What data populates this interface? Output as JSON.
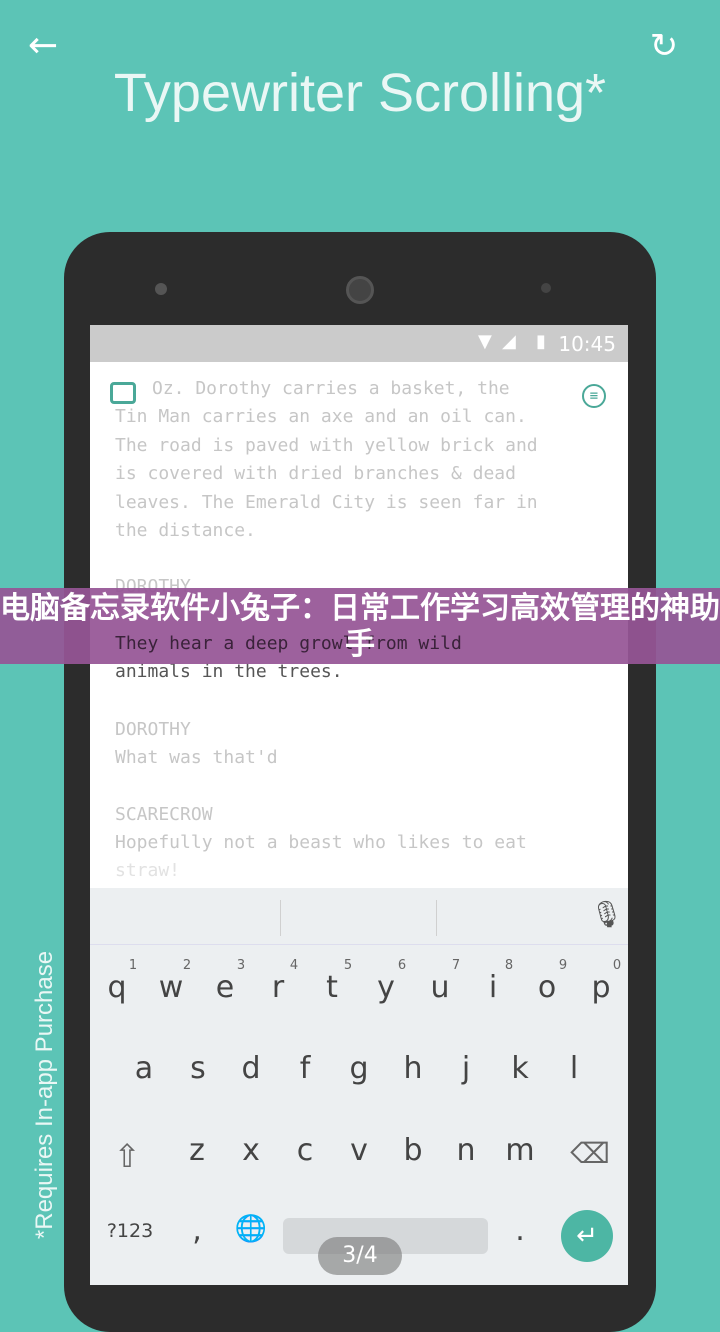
{
  "viewer": {
    "back_icon": "arrow-left-icon",
    "rotate_icon": "rotate-icon",
    "page_indicator": "3/4"
  },
  "banner": {
    "title": "电脑备忘录软件小兔子：日常工作学习高效管理的神助手"
  },
  "image": {
    "headline": "Typewriter Scrolling*",
    "footnote": "*Requires In-app Purchase",
    "status_time": "10:45",
    "doc_lines": [
      "Oz. Dorothy carries a basket, the",
      "Tin Man carries an axe and an oil can.",
      "The road is paved with yellow brick and",
      "is covered with dried branches & dead",
      "leaves. The Emerald City is seen far in",
      "the distance."
    ],
    "char1": "DOROTHY",
    "line1a": "They hear a deep growl from wild",
    "line1b": "animals in the trees.",
    "char2": "DOROTHY",
    "line2": "What was that'd",
    "char3": "SCARECROW",
    "line3a": "Hopefully not a beast who likes to eat",
    "line3b": "straw!",
    "keyboard": {
      "row1": [
        "q",
        "w",
        "e",
        "r",
        "t",
        "y",
        "u",
        "i",
        "o",
        "p"
      ],
      "nums": [
        "1",
        "2",
        "3",
        "4",
        "5",
        "6",
        "7",
        "8",
        "9",
        "0"
      ],
      "row2": [
        "a",
        "s",
        "d",
        "f",
        "g",
        "h",
        "j",
        "k",
        "l"
      ],
      "row3": [
        "z",
        "x",
        "c",
        "v",
        "b",
        "n",
        "m"
      ],
      "symbols": "?123",
      "comma": ",",
      "period": "."
    },
    "accent": "#4db6a4"
  }
}
